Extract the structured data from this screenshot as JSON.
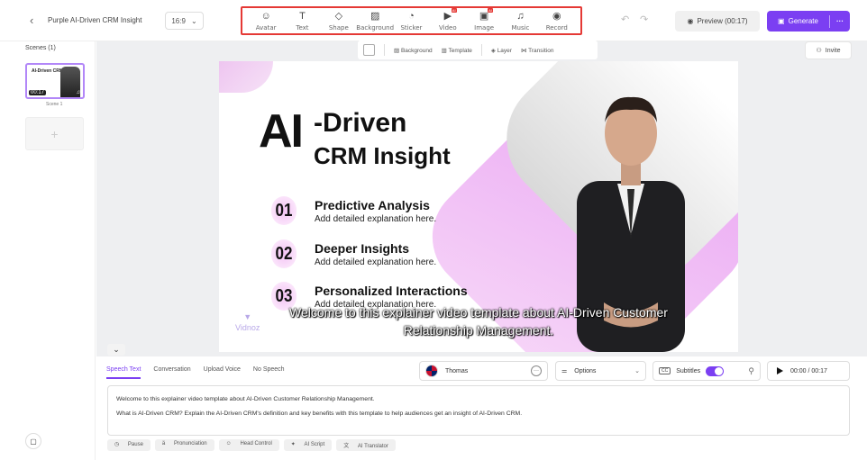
{
  "header": {
    "back_icon": "chevron-left-icon",
    "project_title": "Purple AI-Driven CRM Insight",
    "aspect_ratio": "16:9",
    "tools": [
      {
        "label": "Avatar",
        "icon": "avatar-icon",
        "glyph": "☺"
      },
      {
        "label": "Text",
        "icon": "text-icon",
        "glyph": "T"
      },
      {
        "label": "Shape",
        "icon": "shape-icon",
        "glyph": "◇"
      },
      {
        "label": "Background",
        "icon": "background-icon",
        "glyph": "▨"
      },
      {
        "label": "Sticker",
        "icon": "sticker-icon",
        "glyph": "◔"
      },
      {
        "label": "Video",
        "icon": "video-icon",
        "glyph": "▶",
        "badge": "AI"
      },
      {
        "label": "Image",
        "icon": "image-icon",
        "glyph": "▣",
        "badge": "AI"
      },
      {
        "label": "Music",
        "icon": "music-icon",
        "glyph": "♫"
      },
      {
        "label": "Record",
        "icon": "record-icon",
        "glyph": "◉"
      }
    ],
    "preview_label": "Preview (00:17)",
    "generate_label": "Generate",
    "more_label": "···"
  },
  "sidebar": {
    "scenes_label": "Scenes (1)",
    "scene_thumb_title": "AI-Driven CRM Insight",
    "scene_thumb_time": "00:17",
    "scene_name": "Scene 1",
    "add_scene_glyph": "+"
  },
  "canvas_toolbar": {
    "background_label": "Background",
    "template_label": "Template",
    "layer_label": "Layer",
    "transition_label": "Transition"
  },
  "invite_label": "Invite",
  "slide": {
    "title_big": "AI",
    "title_line1": "-Driven",
    "title_line2": "CRM Insight",
    "items": [
      {
        "num": "01",
        "heading": "Predictive Analysis",
        "desc": "Add detailed explanation here."
      },
      {
        "num": "02",
        "heading": "Deeper Insights",
        "desc": "Add detailed explanation here."
      },
      {
        "num": "03",
        "heading": "Personalized Interactions",
        "desc": "Add detailed explanation here."
      }
    ],
    "watermark": "Vidnoz",
    "subtitle_line1": "Welcome to this explainer video template about AI-Driven Customer",
    "subtitle_line2": "Relationship Management."
  },
  "bottom": {
    "tabs": [
      "Speech Text",
      "Conversation",
      "Upload Voice",
      "No Speech"
    ],
    "voice_name": "Thomas",
    "options_label": "Options",
    "subtitles_label": "Subtitles",
    "cc_label": "CC",
    "time_display": "00:00 / 00:17",
    "script_line1": "Welcome to this explainer video template about AI-Driven Customer Relationship Management.",
    "script_line2": "What is AI-Driven CRM? Explain the AI-Driven CRM's definition and key benefits with this template to help audiences get an insight of AI-Driven CRM.",
    "tool_chips": [
      "Pause",
      "Pronunciation",
      "Head Control",
      "AI Script",
      "AI Translator"
    ]
  }
}
